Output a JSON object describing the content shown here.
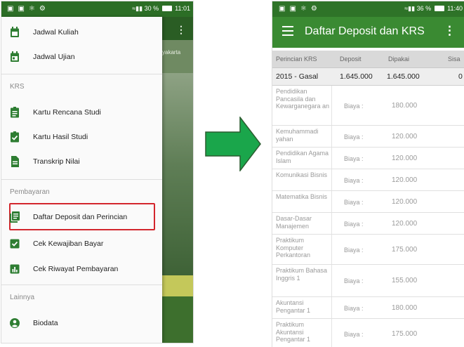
{
  "left_phone": {
    "status_bar": {
      "time": "11:01",
      "battery": "30 %",
      "signal": "≈ ▮▮"
    },
    "background_app": {
      "tab_fragment": "yakarta"
    },
    "drawer": {
      "top_items": [
        {
          "label": "Jadwal Kuliah",
          "icon": "calendar-icon"
        },
        {
          "label": "Jadwal Ujian",
          "icon": "calendar-event-icon"
        }
      ],
      "sections": [
        {
          "title": "KRS",
          "items": [
            {
              "label": "Kartu Rencana Studi",
              "icon": "assignment-icon"
            },
            {
              "label": "Kartu Hasil Studi",
              "icon": "assignment-check-icon"
            },
            {
              "label": "Transkrip Nilai",
              "icon": "document-icon"
            }
          ]
        },
        {
          "title": "Pembayaran",
          "items": [
            {
              "label": "Daftar Deposit dan Perincian",
              "icon": "library-books-icon",
              "highlighted": true
            },
            {
              "label": "Cek Kewajiban Bayar",
              "icon": "check-box-icon"
            },
            {
              "label": "Cek Riwayat Pembayaran",
              "icon": "bar-chart-icon"
            }
          ]
        },
        {
          "title": "Lainnya",
          "items": [
            {
              "label": "Biodata",
              "icon": "account-circle-icon"
            }
          ]
        }
      ]
    }
  },
  "right_phone": {
    "status_bar": {
      "time": "11:40",
      "battery": "36 %"
    },
    "app_bar": {
      "title": "Daftar Deposit dan KRS",
      "menu_icon": "hamburger-icon",
      "more_icon": "more-vert-icon"
    },
    "table": {
      "headers": [
        "Perincian KRS",
        "Deposit",
        "Dipakai",
        "Sisa"
      ],
      "semester_row": {
        "label": "2015 - Gasal",
        "deposit": "1.645.000",
        "dipakai": "1.645.000",
        "sisa": "0"
      },
      "rows": [
        {
          "name": "Pendidikan Pancasila dan Kewarganegara an",
          "type": "Biaya :",
          "amount": "180.000"
        },
        {
          "name": "Kemuhammadi yahan",
          "type": "Biaya :",
          "amount": "120.000"
        },
        {
          "name": "Pendidikan Agama Islam",
          "type": "Biaya :",
          "amount": "120.000"
        },
        {
          "name": "Komunikasi Bisnis",
          "type": "Biaya :",
          "amount": "120.000"
        },
        {
          "name": "Matematika Bisnis",
          "type": "Biaya :",
          "amount": "120.000"
        },
        {
          "name": "Dasar-Dasar Manajemen",
          "type": "Biaya :",
          "amount": "120.000"
        },
        {
          "name": "Praktikum Komputer Perkantoran",
          "type": "Biaya :",
          "amount": "175.000"
        },
        {
          "name": "Praktikum Bahasa Inggris 1",
          "type": "Biaya :",
          "amount": "155.000"
        },
        {
          "name": "Akuntansi Pengantar 1",
          "type": "Biaya :",
          "amount": "180.000"
        },
        {
          "name": "Praktikum Akuntansi Pengantar 1",
          "type": "Biaya :",
          "amount": "175.000"
        }
      ]
    }
  },
  "colors": {
    "primary": "#3a8a32",
    "primary_dark": "#2e7328",
    "highlight_border": "#d3262d",
    "arrow": "#1aa64b"
  }
}
